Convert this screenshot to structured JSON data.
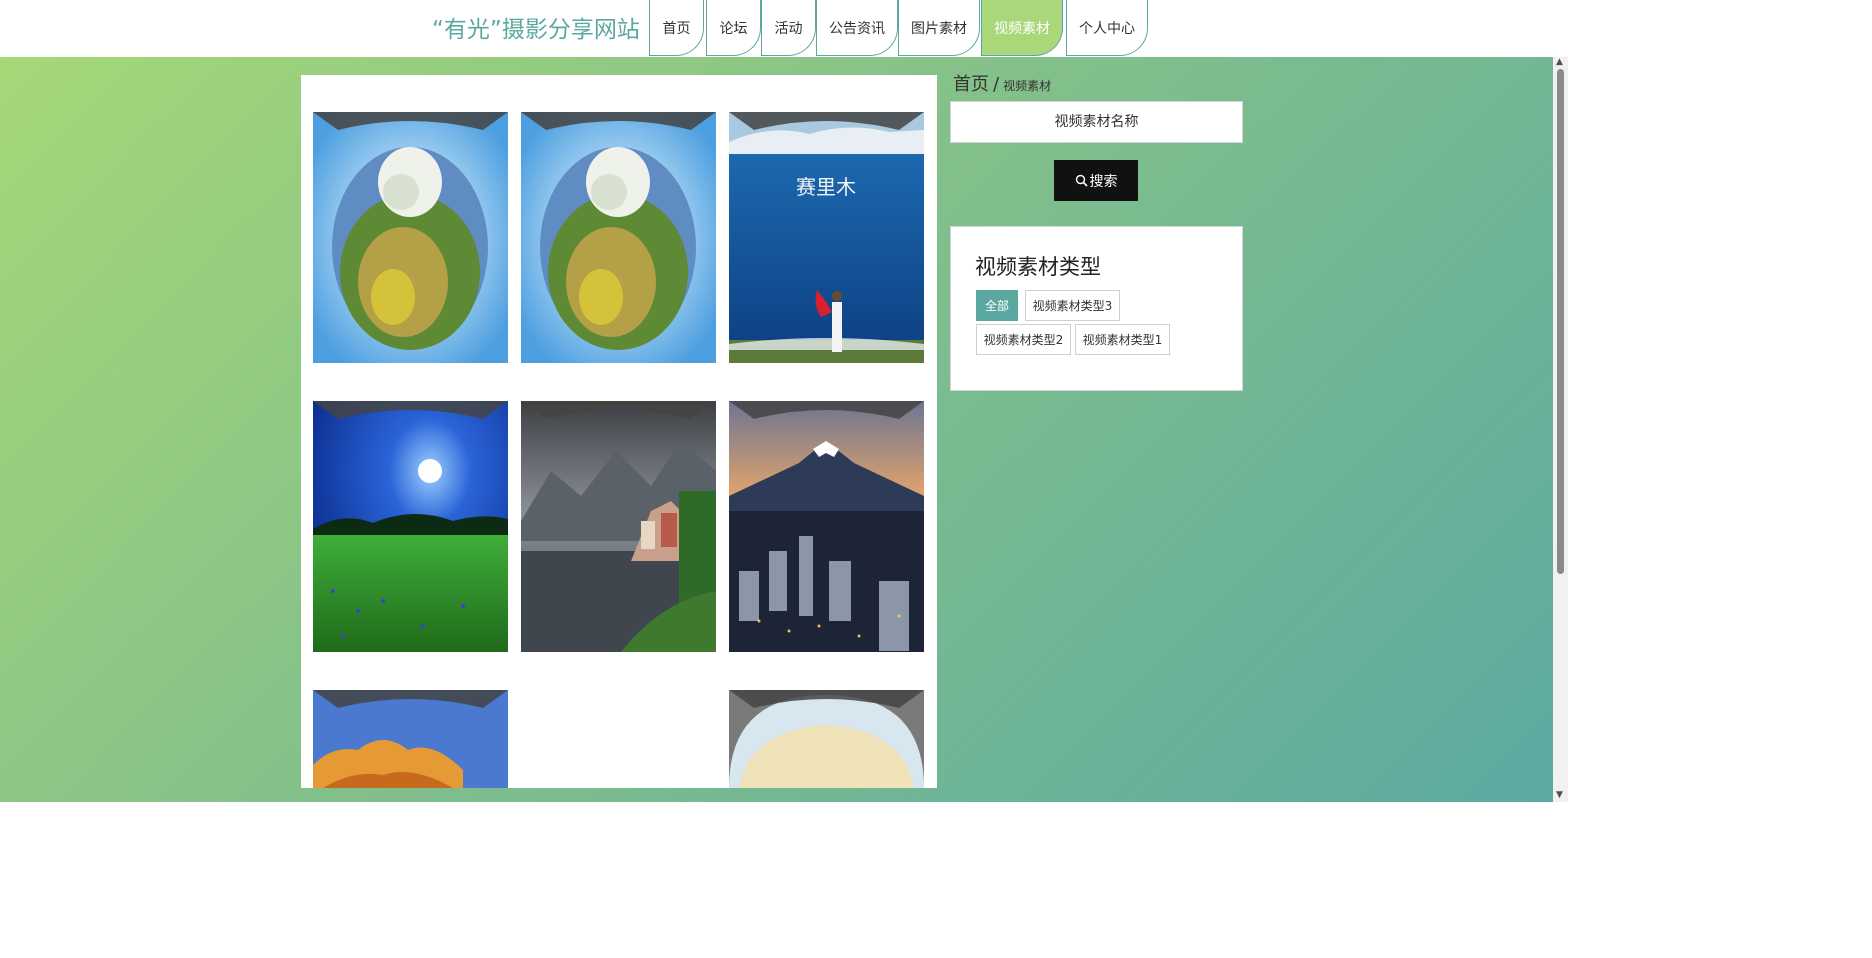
{
  "header": {
    "site_title": "“有光”摄影分享网站",
    "nav": [
      {
        "label": "首页"
      },
      {
        "label": "论坛"
      },
      {
        "label": "活动"
      },
      {
        "label": "公告资讯"
      },
      {
        "label": "图片素材"
      },
      {
        "label": "视频素材",
        "active": true
      },
      {
        "label": "个人中心"
      }
    ]
  },
  "breadcrumb": {
    "home": "首页",
    "separator": "/",
    "current": "视频素材"
  },
  "search": {
    "placeholder": "视频素材名称",
    "button_label": "搜索",
    "icon": "search-icon"
  },
  "type_panel": {
    "title": "视频素材类型",
    "tags": [
      {
        "label": "全部",
        "active": true
      },
      {
        "label": "视频素材类型3"
      },
      {
        "label": "视频素材类型2"
      },
      {
        "label": "视频素材类型1"
      }
    ]
  },
  "gallery": {
    "items": [
      {
        "name": "tiny-planet-tree-1"
      },
      {
        "name": "tiny-planet-tree-2"
      },
      {
        "name": "lake-woman-red-scarf",
        "watermark": "赛里木"
      },
      {
        "name": "moonlit-meadow"
      },
      {
        "name": "lakeside-village"
      },
      {
        "name": "mount-fuji-city"
      },
      {
        "name": "orange-rock-blue-sky"
      },
      {
        "name": "empty-slot"
      },
      {
        "name": "sunset-dome"
      }
    ]
  },
  "colors": {
    "accent": "#5ba8a0",
    "active_tab": "#a9d77a",
    "gradient_start": "#a5d877",
    "gradient_end": "#5aa9a2",
    "search_button": "#111111"
  }
}
